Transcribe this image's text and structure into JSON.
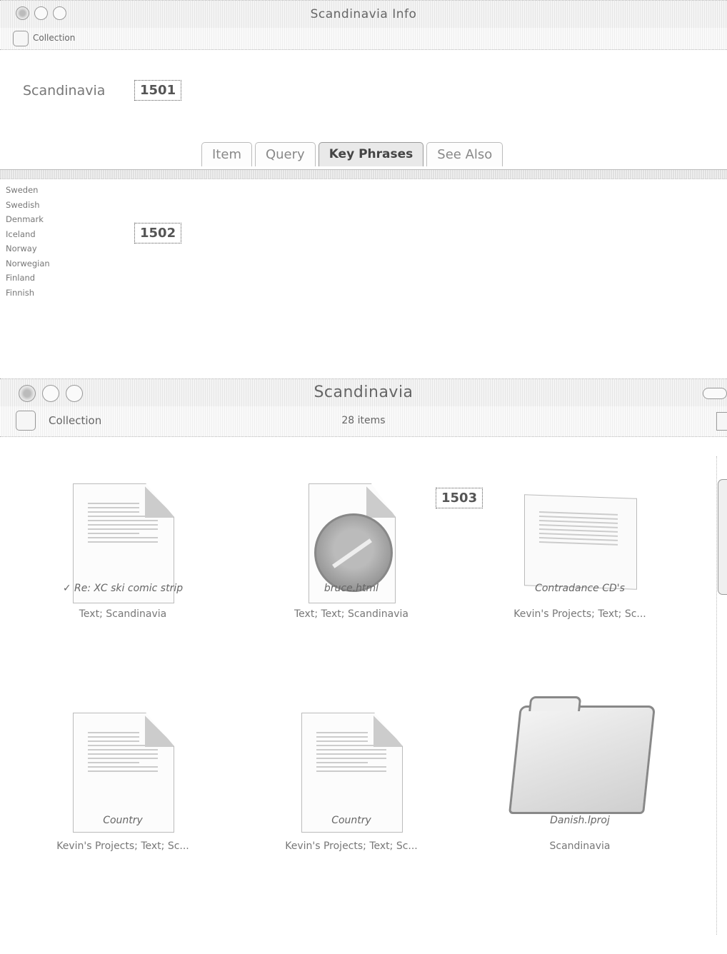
{
  "info_window": {
    "title": "Scandinavia Info",
    "toolbar_label": "Collection",
    "collection_name": "Scandinavia",
    "callout_1": "1501",
    "callout_2": "1502",
    "tabs": [
      "Item",
      "Query",
      "Key Phrases",
      "See Also"
    ],
    "active_tab": "Key Phrases",
    "key_phrases": [
      "Sweden",
      "Swedish",
      "Denmark",
      "Iceland",
      "Norway",
      "Norwegian",
      "Finland",
      "Finnish"
    ]
  },
  "main_window": {
    "title": "Scandinavia",
    "toolbar_label": "Collection",
    "item_count": "28 items",
    "callout_3": "1503",
    "items": [
      {
        "name": "Re: XC ski comic strip",
        "meta": "Text; Scandinavia",
        "icon": "text-document-icon",
        "checked": true
      },
      {
        "name": "bruce.html",
        "meta": "Text; Text; Scandinavia",
        "icon": "web-document-icon"
      },
      {
        "name": "Contradance CD's",
        "meta": "Kevin's Projects; Text; Sc...",
        "icon": "note-icon"
      },
      {
        "name": "Country",
        "meta": "Kevin's Projects; Text; Sc...",
        "icon": "text-document-icon"
      },
      {
        "name": "Country",
        "meta": "Kevin's Projects; Text; Sc...",
        "icon": "text-document-icon"
      },
      {
        "name": "Danish.lproj",
        "meta": "Scandinavia",
        "icon": "folder-icon"
      }
    ]
  }
}
